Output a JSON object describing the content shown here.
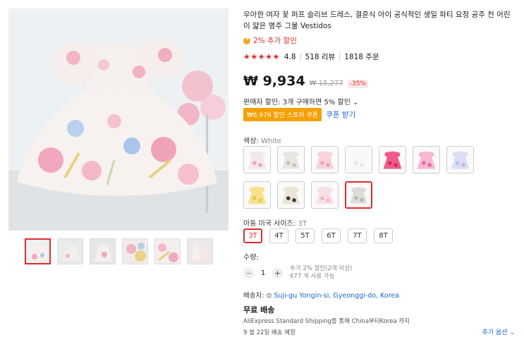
{
  "product": {
    "title": "우아한 여자 꽃 퍼프 슬리브 드레스, 결혼식 아이 공식적인 생일 파티 요정 공주 천 어린이 얇은 명주 그물 Vestidos",
    "promo": "2% 추가 할인",
    "rating": "4.8",
    "reviews": "518 리뷰",
    "orders": "1818 주문",
    "stars": "★★★★★",
    "price": "₩ 9,934",
    "old_price": "₩ 15,277",
    "discount": "-35%",
    "seller_discount": "판매자 할인: 3개 구매하면 5% 할인 ⌄",
    "store_coupon": "₩6,976 할인 스토어 쿠폰",
    "get_coupon": "쿠폰 받기"
  },
  "color": {
    "label": "색상:",
    "value": "White",
    "swatches": [
      {
        "name": "floral-white",
        "bg": "#f3e6ee",
        "accent": "#e8a3c0"
      },
      {
        "name": "gray-beige",
        "bg": "#e9e6e2",
        "accent": "#c8c1b8"
      },
      {
        "name": "pink",
        "bg": "#f7d3da",
        "accent": "#ee9fb1"
      },
      {
        "name": "white",
        "bg": "#f8f8f8",
        "accent": "#e6e6e6"
      },
      {
        "name": "rose-red",
        "bg": "#ef5b8a",
        "accent": "#d8285f"
      },
      {
        "name": "hot-pink",
        "bg": "#f8b7d2",
        "accent": "#ee66a3"
      },
      {
        "name": "lavender-blue",
        "bg": "#dcdff4",
        "accent": "#b8bde9"
      },
      {
        "name": "yellow",
        "bg": "#f5e28f",
        "accent": "#e8c84f"
      },
      {
        "name": "black-beige",
        "bg": "#ece4d6",
        "accent": "#3a3a3a"
      },
      {
        "name": "light-pink",
        "bg": "#f9e0e6",
        "accent": "#f0b6c5"
      },
      {
        "name": "gray-sequin",
        "bg": "#dedcd8",
        "accent": "#b9b6b0"
      }
    ]
  },
  "size": {
    "label": "아동 미국 사이즈:",
    "value": "3T",
    "options": [
      "3T",
      "4T",
      "5T",
      "6T",
      "7T",
      "8T"
    ]
  },
  "quantity": {
    "label": "수량:",
    "value": "1",
    "minus": "−",
    "plus": "+",
    "info1": "추가 2% 할인(2개 이상)",
    "info2": "677 개 사용 가능"
  },
  "shipping": {
    "ship_to_label": "배송지:",
    "pin": "⊙",
    "location": "Suji-gu Yongin-si, Gyeonggi-do, Korea",
    "free": "무료 배송",
    "method": "AliExpress Standard Shipping를 통해 China부터Korea 까지",
    "date": "9 월 22일 배송 예정",
    "more": "추가 옵션 ⌄"
  }
}
